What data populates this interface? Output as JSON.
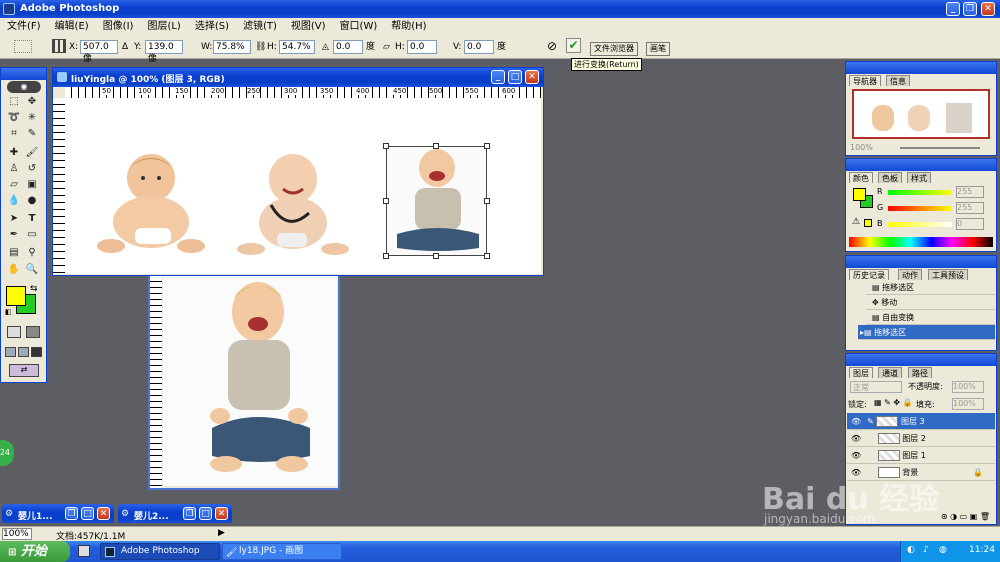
{
  "app": {
    "title": "Adobe Photoshop"
  },
  "menu": [
    "文件(F)",
    "编辑(E)",
    "图像(I)",
    "图层(L)",
    "选择(S)",
    "滤镜(T)",
    "视图(V)",
    "窗口(W)",
    "帮助(H)"
  ],
  "options": {
    "x_label": "X:",
    "x_value": "507.0 像",
    "y_label": "Y:",
    "y_value": "139.0 像",
    "w_label": "W:",
    "w_value": "75.8%",
    "h_label": "H:",
    "h_value": "54.7%",
    "rot_value": "0.0",
    "rot_unit": "度",
    "skewh_label": "H:",
    "skewh_value": "0.0",
    "skewv_label": "V:",
    "skewv_value": "0.0",
    "skew_unit": "度",
    "tab_browser": "文件浏览器",
    "tab_brush": "画笔",
    "tooltip": "进行变换(Return)"
  },
  "document": {
    "title": "liuYingla @ 100% (图层 3, RGB)",
    "ruler_ticks": [
      "50",
      "100",
      "150",
      "200",
      "250",
      "300",
      "350",
      "400",
      "450",
      "500",
      "550",
      "600"
    ]
  },
  "navigator": {
    "tabs": [
      "导航器",
      "信息"
    ],
    "zoom": "100%"
  },
  "color_panel": {
    "tabs": [
      "颜色",
      "色板",
      "样式"
    ],
    "r_label": "R",
    "r_value": "255",
    "g_label": "G",
    "g_value": "255",
    "b_label": "B",
    "b_value": "0"
  },
  "history": {
    "tabs": [
      "历史记录",
      "动作",
      "工具预设"
    ],
    "items": [
      "拖移选区",
      "移动",
      "自由变换",
      "拖移选区"
    ]
  },
  "layers": {
    "tabs": [
      "图层",
      "通道",
      "路径"
    ],
    "mode": "正常",
    "opacity_label": "不透明度:",
    "opacity": "100%",
    "lock_label": "锁定:",
    "fill_label": "填充:",
    "fill": "100%",
    "items": [
      "图层 3",
      "图层 2",
      "图层 1",
      "背景"
    ]
  },
  "minimized": [
    "婴儿1...",
    "婴儿2..."
  ],
  "status": {
    "zoom": "100%",
    "doc": "文档:457K/1.1M"
  },
  "taskbar": {
    "start": "开始",
    "items": [
      "Adobe Photoshop",
      "ly18.JPG - 画图"
    ],
    "clock": "11:24"
  },
  "watermark": {
    "brand": "Bai du 经验",
    "url": "jingyan.baidu.com"
  },
  "side_badge": "24",
  "colors": {
    "foreground": "#ffff00",
    "background": "#22cc22",
    "title_blue": "#0a3fd0"
  }
}
